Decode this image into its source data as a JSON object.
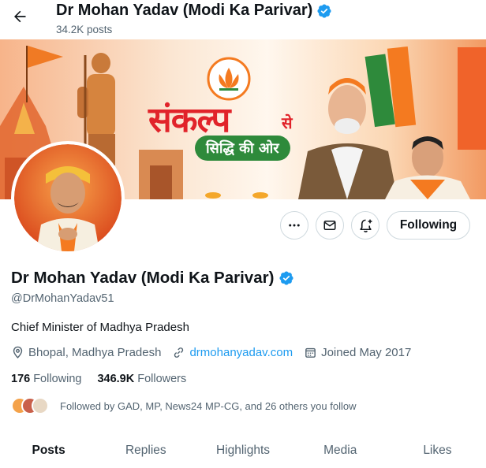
{
  "header": {
    "title": "Dr Mohan Yadav (Modi Ka Parivar)",
    "posts_count": "34.2K posts"
  },
  "banner": {
    "headline": "संकल्प",
    "headline_suffix": "से",
    "tagline": "सिद्धि की ओर"
  },
  "profile": {
    "name": "Dr Mohan Yadav (Modi Ka Parivar)",
    "handle": "@DrMohanYadav51",
    "bio": "Chief Minister of Madhya Pradesh",
    "location": "Bhopal, Madhya Pradesh",
    "website": "drmohanyadav.com",
    "joined": "Joined May 2017",
    "following_count": "176",
    "following_label": "Following",
    "followers_count": "346.9K",
    "followers_label": "Followers",
    "followed_by": "Followed by GAD, MP, News24 MP-CG, and 26 others you follow"
  },
  "actions": {
    "following_button": "Following",
    "more_icon": "more-horizontal-icon",
    "message_icon": "mail-icon",
    "notify_icon": "bell-plus-icon"
  },
  "tabs": [
    {
      "label": "Posts",
      "active": true
    },
    {
      "label": "Replies",
      "active": false
    },
    {
      "label": "Highlights",
      "active": false
    },
    {
      "label": "Media",
      "active": false
    },
    {
      "label": "Likes",
      "active": false
    }
  ],
  "colors": {
    "verified_blue": "#1d9bf0",
    "link_blue": "#1d9bf0",
    "secondary_text": "#536471",
    "accent_saffron": "#f47a20",
    "headline_red": "#e1232a",
    "tagline_green": "#2e8a3b"
  }
}
